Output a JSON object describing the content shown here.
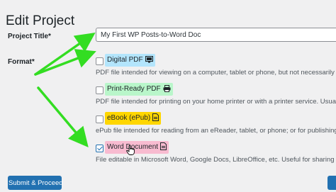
{
  "page": {
    "title": "Edit Project"
  },
  "form": {
    "project_title_label": "Project Title*",
    "project_title_value": "My First WP Posts-to-Word Doc",
    "format_label": "Format*",
    "submit_label": "Submit & Proceed"
  },
  "formats": [
    {
      "label": "Digital PDF",
      "color": "#b3e5fc",
      "icon": "monitor-icon",
      "checked": false,
      "description": "PDF file intended for viewing on a computer, tablet or phone, but not necessarily for printing"
    },
    {
      "label": "Print-Ready PDF",
      "color": "#b9f6ca",
      "icon": "printer-icon",
      "checked": false,
      "description": "PDF file intended for printing on your home printer or with a printer service. Usually removes"
    },
    {
      "label": "eBook (ePub)",
      "color": "#ffd600",
      "icon": "ebook-icon",
      "checked": false,
      "description": "ePub file intended for reading from an eReader, tablet, or phone; or for publishing on an eboo"
    },
    {
      "label": "Word Document",
      "color": "#f8bbd0",
      "icon": "word-doc-icon",
      "checked": true,
      "description": "File editable in Microsoft Word, Google Docs, LibreOffice, etc. Useful for sharing persons and p"
    }
  ],
  "annotations": {
    "arrow_color": "#33dd22"
  }
}
